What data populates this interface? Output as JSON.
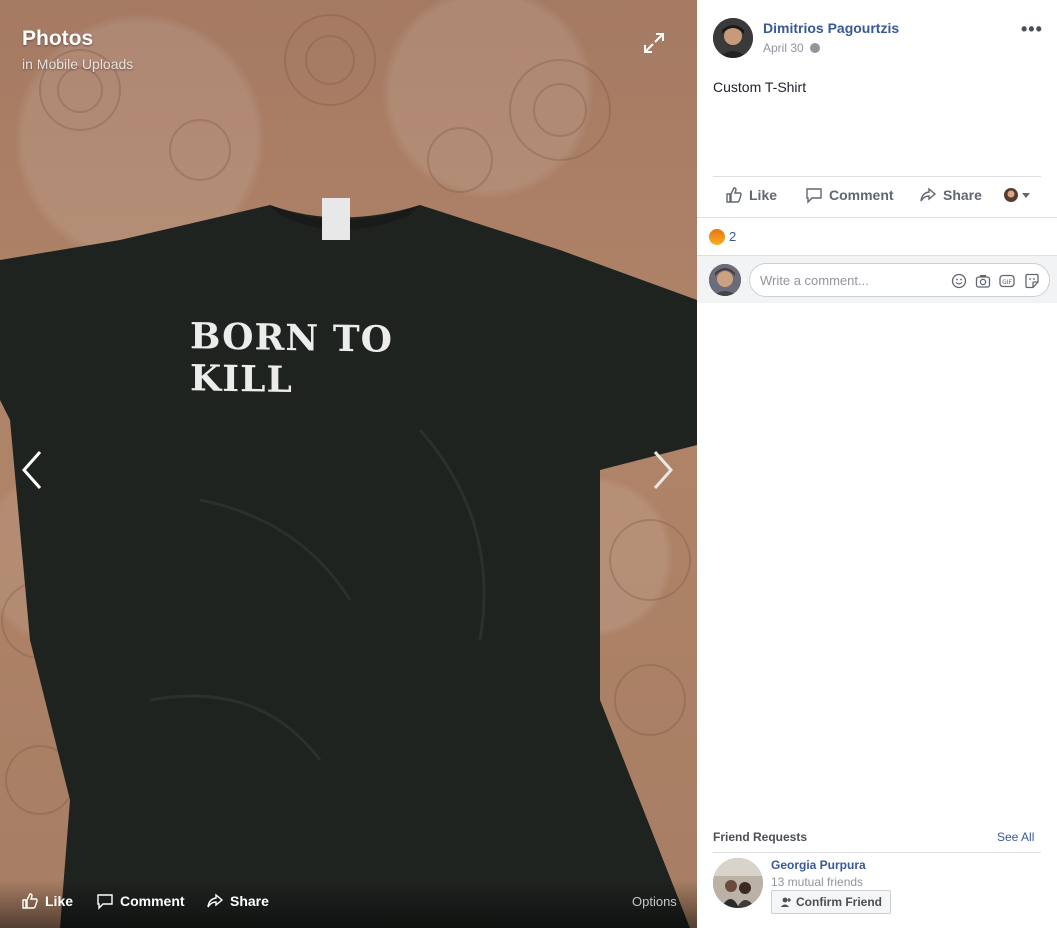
{
  "photo_viewer": {
    "title": "Photos",
    "album": "in Mobile Uploads",
    "shirt_text": "BORN TO KILL",
    "actions": {
      "like": "Like",
      "comment": "Comment",
      "share": "Share",
      "options": "Options"
    }
  },
  "post": {
    "author": "Dimitrios Pagourtzis",
    "date": "April 30",
    "privacy_icon": "globe-icon",
    "caption": "Custom T-Shirt",
    "actions": {
      "like": "Like",
      "comment": "Comment",
      "share": "Share"
    },
    "reactions": {
      "icon": "angry-reaction-icon",
      "count": "2"
    },
    "comment_placeholder": "Write a comment..."
  },
  "friend_requests": {
    "title": "Friend Requests",
    "see_all": "See All",
    "items": [
      {
        "name": "Georgia Purpura",
        "mutual": "13 mutual friends",
        "button": "Confirm Friend"
      }
    ]
  },
  "colors": {
    "link": "#385898",
    "muted": "#90949c",
    "divider": "#dddfe2"
  }
}
